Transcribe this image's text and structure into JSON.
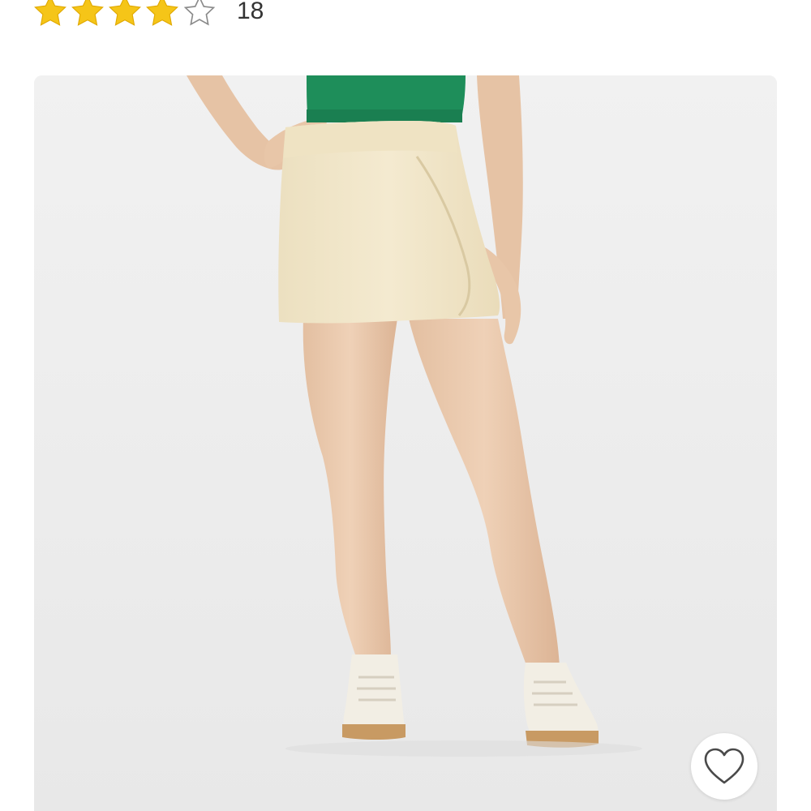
{
  "rating": {
    "value": 4,
    "max": 5,
    "review_count": "18",
    "filled_color": "#F5C518",
    "empty_color": "#8a8a8a"
  },
  "product": {
    "image_background": "#ececec",
    "top_color": "#1e8e5a",
    "skirt_color": "#f1e6c8",
    "skin_color": "#eac9ae"
  },
  "favorite": {
    "icon": "heart-outline-icon",
    "selected": false
  }
}
